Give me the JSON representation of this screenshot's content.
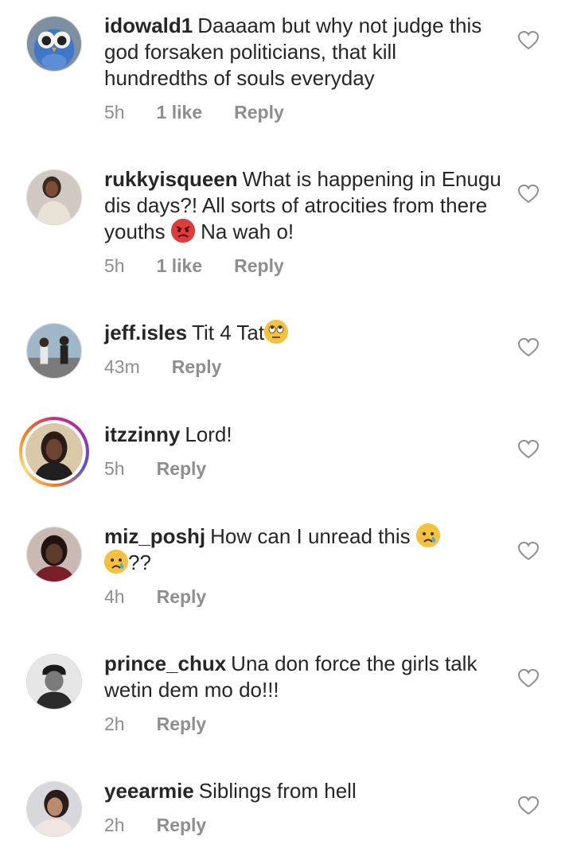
{
  "comments": [
    {
      "username": "idowald1",
      "text_parts": [
        "Daaaam  but why not judge this god forsaken politicians, that kill hundredths of  souls everyday"
      ],
      "time": "5h",
      "likes": "1 like",
      "reply": "Reply"
    },
    {
      "username": "rukkyisqueen",
      "text_a": "What is happening in Enugu dis days?! All sorts of atrocities from there youths",
      "emoji_a": "angry-face-emoji",
      "text_b": "Na wah o!",
      "time": "5h",
      "likes": "1 like",
      "reply": "Reply"
    },
    {
      "username": "jeff.isles",
      "text_a": "Tit 4 Tat",
      "emoji_a": "eye-roll-emoji",
      "time": "43m",
      "reply": "Reply"
    },
    {
      "username": "itzzinny",
      "text_a": "Lord!",
      "time": "5h",
      "reply": "Reply",
      "has_story": true
    },
    {
      "username": "miz_poshj",
      "text_a": "How can I unread this",
      "emoji_a": "crying-face-emoji",
      "emoji_b": "crying-face-emoji",
      "text_b": "??",
      "time": "4h",
      "reply": "Reply"
    },
    {
      "username": "prince_chux",
      "text_a": "Una don force the girls talk wetin dem mo do!!!",
      "time": "2h",
      "reply": "Reply"
    },
    {
      "username": "yeearmie",
      "text_a": "Siblings from hell",
      "time": "2h",
      "reply": "Reply"
    }
  ],
  "colors": {
    "text": "#262626",
    "meta": "#8e8e8e",
    "heart": "#8e8e8e",
    "angry_emoji": "#e03a3a",
    "yellow_emoji": "#f5c33b"
  }
}
